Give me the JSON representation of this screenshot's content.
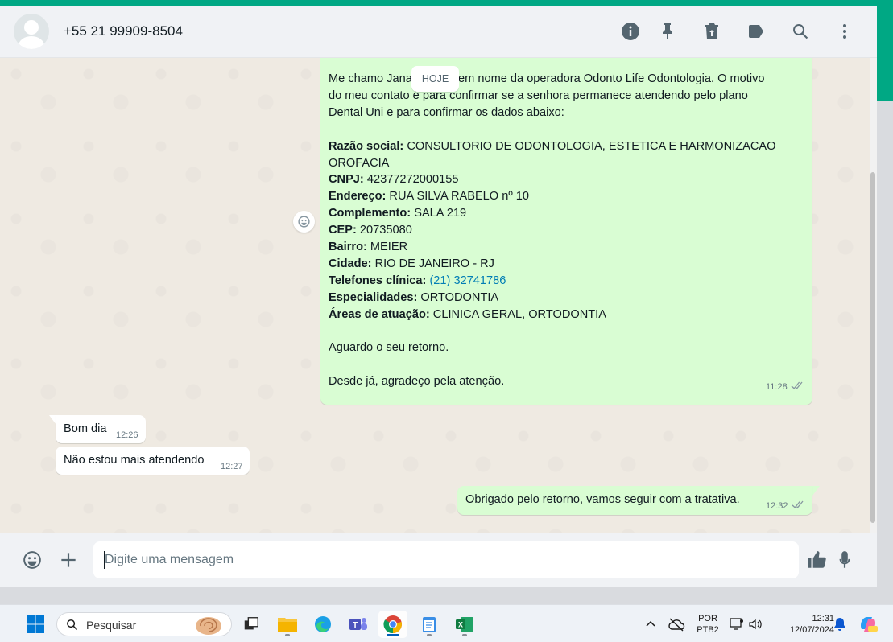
{
  "header": {
    "contact": "+55 21 99909-8504",
    "icons": [
      "info-icon",
      "pin-icon",
      "delete-icon",
      "label-icon",
      "search-icon",
      "menu-icon"
    ]
  },
  "chat": {
    "date_chip": "HOJE",
    "message1": {
      "line_top": "Me chamo Jana",
      "line_top_rest": "o em nome da operadora Odonto Life Odontologia. O motivo",
      "line2": "do meu contato é para confirmar se a senhora permanece atendendo pelo plano",
      "line3": "Dental Uni e para confirmar os dados abaixo:",
      "fields": [
        {
          "label": "Razão social:",
          "value": " CONSULTORIO DE ODONTOLOGIA, ESTETICA E HARMONIZACAO"
        },
        {
          "label": "",
          "value": "OROFACIA"
        },
        {
          "label": "CNPJ:",
          "value": " 42377272000155"
        },
        {
          "label": "Endereço:",
          "value": " RUA SILVA RABELO nº 10"
        },
        {
          "label": "Complemento:",
          "value": " SALA 219"
        },
        {
          "label": "CEP:",
          "value": " 20735080"
        },
        {
          "label": "Bairro:",
          "value": " MEIER"
        },
        {
          "label": "Cidade:",
          "value": " RIO DE JANEIRO - RJ"
        },
        {
          "label": "Telefones clínica:",
          "value": " (21) 32741786"
        },
        {
          "label": "Especialidades:",
          "value": " ORTODONTIA"
        },
        {
          "label": "Áreas de atuação:",
          "value": " CLINICA GERAL, ORTODONTIA"
        }
      ],
      "closing1": "Aguardo o seu retorno.",
      "closing2": "Desde já, agradeço pela atenção.",
      "time": "11:28"
    },
    "message2": {
      "text": "Bom dia",
      "time": "12:26"
    },
    "message3": {
      "text": "Não estou mais atendendo",
      "time": "12:27"
    },
    "message4": {
      "text": "Obrigado pelo retorno, vamos seguir com a tratativa.",
      "time": "12:32"
    }
  },
  "footer": {
    "placeholder": "Digite uma mensagem"
  },
  "taskbar": {
    "search_label": "Pesquisar",
    "lang_top": "POR",
    "lang_bottom": "PTB2",
    "time": "12:31",
    "date": "12/07/2024"
  },
  "colors": {
    "accent": "#00a884",
    "outgoing_bubble": "#d9fdd3",
    "chat_background": "#efeae2",
    "link": "#027eb5"
  }
}
